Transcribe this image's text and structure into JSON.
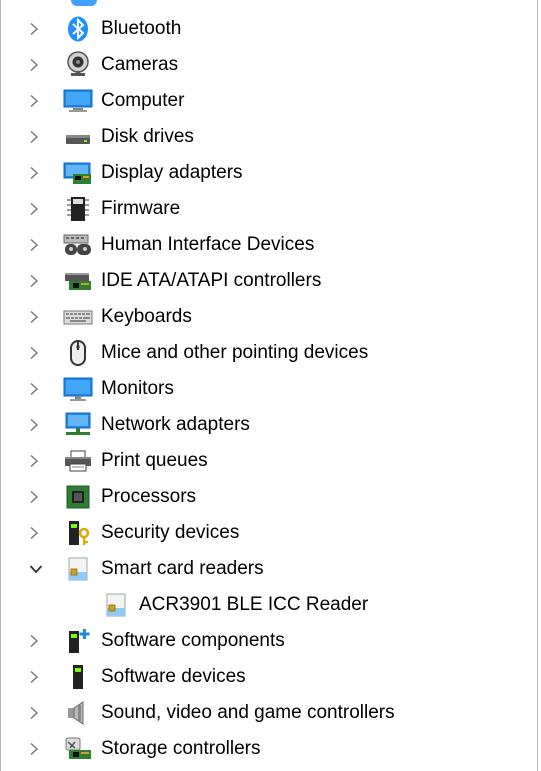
{
  "tree": {
    "items": [
      {
        "label": "Bluetooth",
        "expanded": false,
        "icon": "bluetooth-icon"
      },
      {
        "label": "Cameras",
        "expanded": false,
        "icon": "camera-icon"
      },
      {
        "label": "Computer",
        "expanded": false,
        "icon": "computer-icon"
      },
      {
        "label": "Disk drives",
        "expanded": false,
        "icon": "disk-drive-icon"
      },
      {
        "label": "Display adapters",
        "expanded": false,
        "icon": "display-adapter-icon"
      },
      {
        "label": "Firmware",
        "expanded": false,
        "icon": "firmware-chip-icon"
      },
      {
        "label": "Human Interface Devices",
        "expanded": false,
        "icon": "hid-icon"
      },
      {
        "label": "IDE ATA/ATAPI controllers",
        "expanded": false,
        "icon": "ide-controller-icon"
      },
      {
        "label": "Keyboards",
        "expanded": false,
        "icon": "keyboard-icon"
      },
      {
        "label": "Mice and other pointing devices",
        "expanded": false,
        "icon": "mouse-icon"
      },
      {
        "label": "Monitors",
        "expanded": false,
        "icon": "monitor-icon"
      },
      {
        "label": "Network adapters",
        "expanded": false,
        "icon": "network-adapter-icon"
      },
      {
        "label": "Print queues",
        "expanded": false,
        "icon": "printer-icon"
      },
      {
        "label": "Processors",
        "expanded": false,
        "icon": "processor-icon"
      },
      {
        "label": "Security devices",
        "expanded": false,
        "icon": "security-device-icon"
      },
      {
        "label": "Smart card readers",
        "expanded": true,
        "icon": "smart-card-reader-icon"
      },
      {
        "label": "ACR3901 BLE ICC Reader",
        "child": true,
        "icon": "smart-card-reader-icon"
      },
      {
        "label": "Software components",
        "expanded": false,
        "icon": "software-component-icon"
      },
      {
        "label": "Software devices",
        "expanded": false,
        "icon": "software-device-icon"
      },
      {
        "label": "Sound, video and game controllers",
        "expanded": false,
        "icon": "speaker-icon"
      },
      {
        "label": "Storage controllers",
        "expanded": false,
        "icon": "storage-controller-icon"
      }
    ]
  },
  "colors": {
    "chevron": "#7a7a7a",
    "bluetooth": "#1e90ff",
    "monitor_blue": "#1e88e5"
  }
}
